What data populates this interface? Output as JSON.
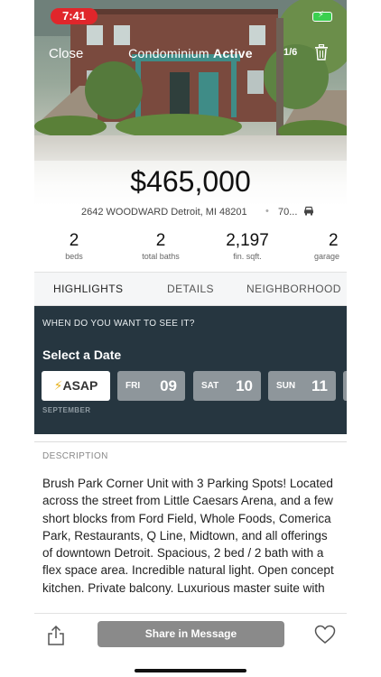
{
  "status_bar": {
    "time": "7:41"
  },
  "header": {
    "close_label": "Close",
    "title_prefix": "Condominium",
    "title_status": "Active",
    "photo_counter": "1/6"
  },
  "listing": {
    "price": "$465,000",
    "address": "2642 WOODWARD Detroit, MI 48201",
    "distance": "70...",
    "stats": [
      {
        "value": "2",
        "label": "beds"
      },
      {
        "value": "2",
        "label": "total baths"
      },
      {
        "value": "2,197",
        "label": "fin. sqft."
      },
      {
        "value": "2",
        "label": "garage"
      }
    ]
  },
  "tabs": [
    "HIGHLIGHTS",
    "DETAILS",
    "NEIGHBORHOOD"
  ],
  "schedule": {
    "question": "WHEN DO YOU WANT TO SEE IT?",
    "heading": "Select a Date",
    "asap_label": "ASAP",
    "dates": [
      {
        "dow": "FRI",
        "day": "09"
      },
      {
        "dow": "SAT",
        "day": "10"
      },
      {
        "dow": "SUN",
        "day": "11"
      }
    ],
    "month": "SEPTEMBER"
  },
  "description": {
    "label": "DESCRIPTION",
    "text": "Brush Park Corner Unit with 3 Parking Spots! Located across the street from Little Caesars Arena, and a few short blocks from Ford Field, Whole Foods, Comerica Park, Restaurants, Q Line, Midtown, and all offerings of downtown Detroit. Spacious, 2 bed / 2 bath with a flex space area. Incredible natural light. Open concept kitchen. Private balcony. Luxurious master suite with"
  },
  "bottom_bar": {
    "share_message_label": "Share in Message"
  },
  "colors": {
    "schedule_bg": "#263640",
    "date_card": "#8e969b",
    "status_time_bg": "#e0262b",
    "message_button": "#8a8a8a"
  },
  "icons": [
    "trash-icon",
    "car-icon",
    "lightning-icon",
    "share-icon",
    "heart-icon",
    "battery-icon"
  ]
}
